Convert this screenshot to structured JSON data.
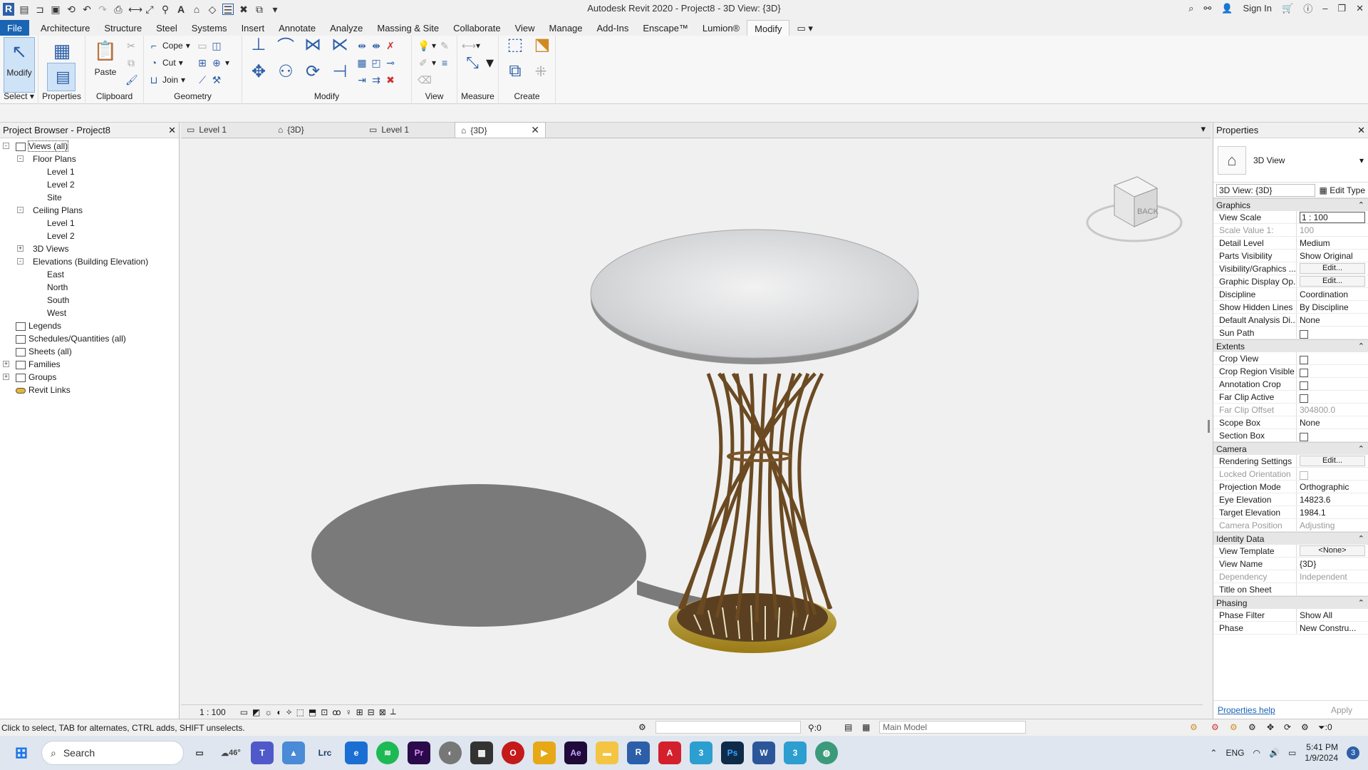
{
  "window": {
    "title": "Autodesk Revit 2020 - Project8 - 3D View: {3D}",
    "sign_in": "Sign In"
  },
  "menu": {
    "tabs": [
      "File",
      "Architecture",
      "Structure",
      "Steel",
      "Systems",
      "Insert",
      "Annotate",
      "Analyze",
      "Massing & Site",
      "Collaborate",
      "View",
      "Manage",
      "Add-Ins",
      "Enscape™",
      "Lumion®",
      "Modify"
    ]
  },
  "ribbon": {
    "select_label": "Select",
    "modify_label": "Modify",
    "properties_label": "Properties",
    "paste_label": "Paste",
    "clipboard_label": "Clipboard",
    "cope_label": "Cope",
    "cut_label": "Cut",
    "join_label": "Join",
    "geometry_label": "Geometry",
    "modify_panel_label": "Modify",
    "view_label": "View",
    "measure_label": "Measure",
    "create_label": "Create"
  },
  "project_browser": {
    "title": "Project Browser - Project8",
    "items": [
      {
        "label": "Views (all)",
        "level": 0,
        "toggle": "-",
        "icon": "views-icon"
      },
      {
        "label": "Floor Plans",
        "level": 1,
        "toggle": "-"
      },
      {
        "label": "Level 1",
        "level": 2
      },
      {
        "label": "Level 2",
        "level": 2
      },
      {
        "label": "Site",
        "level": 2
      },
      {
        "label": "Ceiling Plans",
        "level": 1,
        "toggle": "-"
      },
      {
        "label": "Level 1",
        "level": 2
      },
      {
        "label": "Level 2",
        "level": 2
      },
      {
        "label": "3D Views",
        "level": 1,
        "toggle": "+"
      },
      {
        "label": "Elevations (Building Elevation)",
        "level": 1,
        "toggle": "-"
      },
      {
        "label": "East",
        "level": 2
      },
      {
        "label": "North",
        "level": 2
      },
      {
        "label": "South",
        "level": 2
      },
      {
        "label": "West",
        "level": 2
      },
      {
        "label": "Legends",
        "level": 0,
        "icon": "legend-icon"
      },
      {
        "label": "Schedules/Quantities (all)",
        "level": 0,
        "icon": "schedule-icon"
      },
      {
        "label": "Sheets (all)",
        "level": 0,
        "icon": "sheet-icon"
      },
      {
        "label": "Families",
        "level": 0,
        "toggle": "+",
        "icon": "family-icon"
      },
      {
        "label": "Groups",
        "level": 0,
        "toggle": "+",
        "icon": "group-icon"
      },
      {
        "label": "Revit Links",
        "level": 0,
        "icon": "link-icon"
      }
    ]
  },
  "view_tabs": [
    {
      "label": "Level 1",
      "active": false
    },
    {
      "label": "{3D}",
      "active": false
    },
    {
      "label": "Level 1",
      "active": false
    },
    {
      "label": "{3D}",
      "active": true
    }
  ],
  "viewport": {
    "viewcube_label": "BACK",
    "scale": "1 : 100"
  },
  "properties": {
    "title": "Properties",
    "type_name": "3D View",
    "instance": "3D View: {3D}",
    "edit_type": "Edit Type",
    "groups": [
      {
        "name": "Graphics",
        "rows": [
          {
            "k": "View Scale",
            "v": "1 : 100",
            "kind": "input"
          },
          {
            "k": "Scale Value    1:",
            "v": "100",
            "dim": true
          },
          {
            "k": "Detail Level",
            "v": "Medium"
          },
          {
            "k": "Parts Visibility",
            "v": "Show Original"
          },
          {
            "k": "Visibility/Graphics ...",
            "v": "Edit...",
            "kind": "button"
          },
          {
            "k": "Graphic Display Op...",
            "v": "Edit...",
            "kind": "button"
          },
          {
            "k": "Discipline",
            "v": "Coordination"
          },
          {
            "k": "Show Hidden Lines",
            "v": "By Discipline"
          },
          {
            "k": "Default Analysis Di...",
            "v": "None"
          },
          {
            "k": "Sun Path",
            "v": "",
            "kind": "check"
          }
        ]
      },
      {
        "name": "Extents",
        "rows": [
          {
            "k": "Crop View",
            "v": "",
            "kind": "check"
          },
          {
            "k": "Crop Region Visible",
            "v": "",
            "kind": "check"
          },
          {
            "k": "Annotation Crop",
            "v": "",
            "kind": "check"
          },
          {
            "k": "Far Clip Active",
            "v": "",
            "kind": "check"
          },
          {
            "k": "Far Clip Offset",
            "v": "304800.0",
            "dim": true
          },
          {
            "k": "Scope Box",
            "v": "None"
          },
          {
            "k": "Section Box",
            "v": "",
            "kind": "check"
          }
        ]
      },
      {
        "name": "Camera",
        "rows": [
          {
            "k": "Rendering Settings",
            "v": "Edit...",
            "kind": "button"
          },
          {
            "k": "Locked Orientation",
            "v": "",
            "kind": "check",
            "dim": true
          },
          {
            "k": "Projection Mode",
            "v": "Orthographic"
          },
          {
            "k": "Eye Elevation",
            "v": "14823.6"
          },
          {
            "k": "Target Elevation",
            "v": "1984.1"
          },
          {
            "k": "Camera Position",
            "v": "Adjusting",
            "dim": true
          }
        ]
      },
      {
        "name": "Identity Data",
        "rows": [
          {
            "k": "View Template",
            "v": "<None>",
            "kind": "button"
          },
          {
            "k": "View Name",
            "v": "{3D}"
          },
          {
            "k": "Dependency",
            "v": "Independent",
            "dim": true
          },
          {
            "k": "Title on Sheet",
            "v": ""
          }
        ]
      },
      {
        "name": "Phasing",
        "rows": [
          {
            "k": "Phase Filter",
            "v": "Show All"
          },
          {
            "k": "Phase",
            "v": "New Constru..."
          }
        ]
      }
    ],
    "help": "Properties help",
    "apply": "Apply"
  },
  "status": {
    "hint": "Click to select, TAB for alternates, CTRL adds, SHIFT unselects.",
    "count": ":0",
    "model": "Main Model",
    "filter_count": ":0"
  },
  "taskbar": {
    "search": "Search",
    "weather": "46°",
    "lang": "ENG",
    "time": "5:41 PM",
    "date": "1/9/2024",
    "notif": "3",
    "apps": [
      "Lrc",
      "Pr",
      "Ae",
      "Ps",
      "W"
    ]
  }
}
